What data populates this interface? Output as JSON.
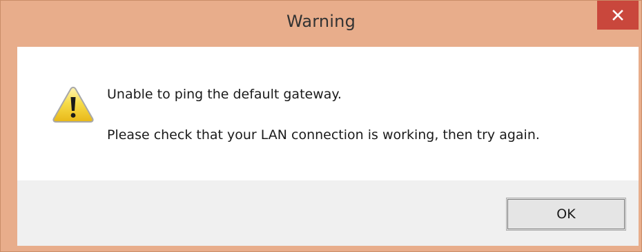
{
  "window": {
    "title": "Warning",
    "close_icon": "close-icon",
    "frame_color": "#e8ad8b",
    "close_color": "#c9473c"
  },
  "message": {
    "icon": "warning-icon",
    "line1": "Unable to ping the default gateway.",
    "line2": "Please check that your LAN connection is working, then try again."
  },
  "buttons": {
    "ok_label": "OK"
  }
}
